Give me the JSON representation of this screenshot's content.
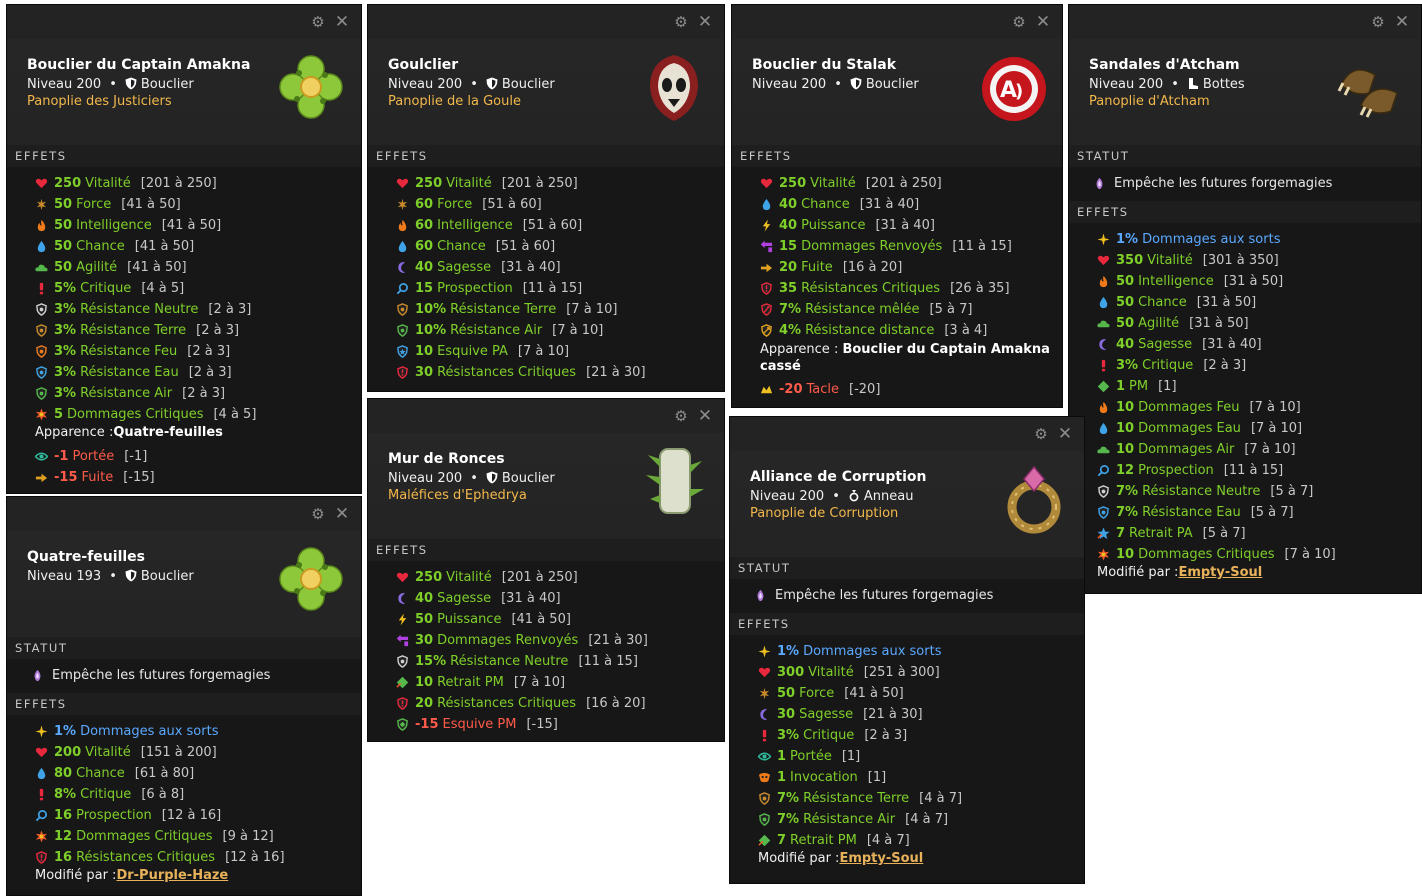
{
  "ui": {
    "gear": "⚙",
    "close": "✕",
    "dot": "•"
  },
  "panels": [
    {
      "name": "Bouclier du Captain Amakna",
      "level": "Niveau 200",
      "type": "Bouclier",
      "set": "Panoplie des Justiciers",
      "sections": [
        {
          "title": "EFFETS",
          "kind": "effects",
          "rows": [
            {
              "v": "250",
              "t": "Vitalité",
              "r": "[201 à 250]",
              "icon": "heart-icon",
              "color": "#e8283c"
            },
            {
              "v": "50",
              "t": "Force",
              "r": "[41 à 50]",
              "icon": "force-icon",
              "color": "#c98a2b"
            },
            {
              "v": "50",
              "t": "Intelligence",
              "r": "[41 à 50]",
              "icon": "fire-icon",
              "color": "#f07a1a"
            },
            {
              "v": "50",
              "t": "Chance",
              "r": "[41 à 50]",
              "icon": "water-drop-icon",
              "color": "#3fa3e8"
            },
            {
              "v": "50",
              "t": "Agilité",
              "r": "[41 à 50]",
              "icon": "air-cloud-icon",
              "color": "#56b84c"
            },
            {
              "v": "5%",
              "t": "Critique",
              "r": "[4 à 5]",
              "icon": "critical-icon",
              "color": "#e8283c"
            },
            {
              "v": "3%",
              "t": "Résistance Neutre",
              "r": "[2 à 3]",
              "icon": "shield-neutral-icon",
              "color": "#d0d0d0"
            },
            {
              "v": "3%",
              "t": "Résistance Terre",
              "r": "[2 à 3]",
              "icon": "shield-earth-icon",
              "color": "#c98a2b"
            },
            {
              "v": "3%",
              "t": "Résistance Feu",
              "r": "[2 à 3]",
              "icon": "shield-fire-icon",
              "color": "#f07a1a"
            },
            {
              "v": "3%",
              "t": "Résistance Eau",
              "r": "[2 à 3]",
              "icon": "shield-water-icon",
              "color": "#3fa3e8"
            },
            {
              "v": "3%",
              "t": "Résistance Air",
              "r": "[2 à 3]",
              "icon": "shield-air-icon",
              "color": "#56b84c"
            },
            {
              "v": "5",
              "t": "Dommages Critiques",
              "r": "[4 à 5]",
              "icon": "critical-damage-icon",
              "color": "#f05a28"
            },
            {
              "plain": true,
              "label": "Apparence : ",
              "value": "Quatre-feuilles"
            },
            {
              "v": "-1",
              "t": "Portée",
              "r": "[-1]",
              "icon": "range-eye-icon",
              "color": "#2fb89a",
              "neg": true
            },
            {
              "v": "-15",
              "t": "Fuite",
              "r": "[-15]",
              "icon": "flee-icon",
              "color": "#e0a020",
              "neg": true
            }
          ]
        }
      ]
    },
    {
      "name": "Goulclier",
      "level": "Niveau 200",
      "type": "Bouclier",
      "set": "Panoplie de la Goule",
      "sections": [
        {
          "title": "EFFETS",
          "kind": "effects",
          "rows": [
            {
              "v": "250",
              "t": "Vitalité",
              "r": "[201 à 250]",
              "icon": "heart-icon",
              "color": "#e8283c"
            },
            {
              "v": "60",
              "t": "Force",
              "r": "[51 à 60]",
              "icon": "force-icon",
              "color": "#c98a2b"
            },
            {
              "v": "60",
              "t": "Intelligence",
              "r": "[51 à 60]",
              "icon": "fire-icon",
              "color": "#f07a1a"
            },
            {
              "v": "60",
              "t": "Chance",
              "r": "[51 à 60]",
              "icon": "water-drop-icon",
              "color": "#3fa3e8"
            },
            {
              "v": "40",
              "t": "Sagesse",
              "r": "[31 à 40]",
              "icon": "wisdom-moon-icon",
              "color": "#8a6ae0"
            },
            {
              "v": "15",
              "t": "Prospection",
              "r": "[11 à 15]",
              "icon": "prospection-icon",
              "color": "#3fa3e8"
            },
            {
              "v": "10%",
              "t": "Résistance Terre",
              "r": "[7 à 10]",
              "icon": "shield-earth-icon",
              "color": "#c98a2b"
            },
            {
              "v": "10%",
              "t": "Résistance Air",
              "r": "[7 à 10]",
              "icon": "shield-air-icon",
              "color": "#56b84c"
            },
            {
              "v": "10",
              "t": "Esquive PA",
              "r": "[7 à 10]",
              "icon": "dodge-ap-icon",
              "color": "#3fa3e8"
            },
            {
              "v": "30",
              "t": "Résistances Critiques",
              "r": "[21 à 30]",
              "icon": "critical-resist-icon",
              "color": "#e8283c"
            }
          ]
        }
      ]
    },
    {
      "name": "Bouclier du Stalak",
      "level": "Niveau 200",
      "type": "Bouclier",
      "set": "",
      "sections": [
        {
          "title": "EFFETS",
          "kind": "effects",
          "rows": [
            {
              "v": "250",
              "t": "Vitalité",
              "r": "[201 à 250]",
              "icon": "heart-icon",
              "color": "#e8283c"
            },
            {
              "v": "40",
              "t": "Chance",
              "r": "[31 à 40]",
              "icon": "water-drop-icon",
              "color": "#3fa3e8"
            },
            {
              "v": "40",
              "t": "Puissance",
              "r": "[31 à 40]",
              "icon": "power-bolt-icon",
              "color": "#f0c020"
            },
            {
              "v": "15",
              "t": "Dommages Renvoyés",
              "r": "[11 à 15]",
              "icon": "reflect-icon",
              "color": "#b040e0"
            },
            {
              "v": "20",
              "t": "Fuite",
              "r": "[16 à 20]",
              "icon": "flee-icon",
              "color": "#e0a020"
            },
            {
              "v": "35",
              "t": "Résistances Critiques",
              "r": "[26 à 35]",
              "icon": "critical-resist-icon",
              "color": "#e8283c"
            },
            {
              "v": "7%",
              "t": "Résistance mêlée",
              "r": "[5 à 7]",
              "icon": "melee-resist-icon",
              "color": "#e8283c"
            },
            {
              "v": "4%",
              "t": "Résistance distance",
              "r": "[3 à 4]",
              "icon": "ranged-resist-icon",
              "color": "#e0a020"
            },
            {
              "plain": true,
              "label": "Apparence : ",
              "value": "Bouclier du Captain Amakna cassé",
              "tall": true
            },
            {
              "v": "-20",
              "t": "Tacle",
              "r": "[-20]",
              "icon": "tackle-icon",
              "color": "#f0c020",
              "neg": true
            }
          ]
        }
      ]
    },
    {
      "name": "Sandales d'Atcham",
      "level": "Niveau 200",
      "type": "Bottes",
      "set": "Panoplie d'Atcham",
      "sections": [
        {
          "title": "STATUT",
          "kind": "statut",
          "text": "Empêche les futures forgemagies"
        },
        {
          "title": "EFFETS",
          "kind": "effects",
          "rows": [
            {
              "v": "1%",
              "t": "Dommages aux sorts",
              "r": "",
              "icon": "spell-damage-icon",
              "color": "#f0c020",
              "blue": true
            },
            {
              "v": "350",
              "t": "Vitalité",
              "r": "[301 à 350]",
              "icon": "heart-icon",
              "color": "#e8283c"
            },
            {
              "v": "50",
              "t": "Intelligence",
              "r": "[31 à 50]",
              "icon": "fire-icon",
              "color": "#f07a1a"
            },
            {
              "v": "50",
              "t": "Chance",
              "r": "[31 à 50]",
              "icon": "water-drop-icon",
              "color": "#3fa3e8"
            },
            {
              "v": "50",
              "t": "Agilité",
              "r": "[31 à 50]",
              "icon": "air-cloud-icon",
              "color": "#56b84c"
            },
            {
              "v": "40",
              "t": "Sagesse",
              "r": "[31 à 40]",
              "icon": "wisdom-moon-icon",
              "color": "#8a6ae0"
            },
            {
              "v": "3%",
              "t": "Critique",
              "r": "[2 à 3]",
              "icon": "critical-icon",
              "color": "#e8283c"
            },
            {
              "v": "1",
              "t": "PM",
              "r": "[1]",
              "icon": "movement-point-icon",
              "color": "#56b84c"
            },
            {
              "v": "10",
              "t": "Dommages Feu",
              "r": "[7 à 10]",
              "icon": "fire-icon",
              "color": "#f07a1a"
            },
            {
              "v": "10",
              "t": "Dommages Eau",
              "r": "[7 à 10]",
              "icon": "water-drop-icon",
              "color": "#3fa3e8"
            },
            {
              "v": "10",
              "t": "Dommages Air",
              "r": "[7 à 10]",
              "icon": "air-cloud-icon",
              "color": "#56b84c"
            },
            {
              "v": "12",
              "t": "Prospection",
              "r": "[11 à 15]",
              "icon": "prospection-icon",
              "color": "#3fa3e8"
            },
            {
              "v": "7%",
              "t": "Résistance Neutre",
              "r": "[5 à 7]",
              "icon": "shield-neutral-icon",
              "color": "#d0d0d0"
            },
            {
              "v": "7%",
              "t": "Résistance Eau",
              "r": "[5 à 7]",
              "icon": "shield-water-icon",
              "color": "#3fa3e8"
            },
            {
              "v": "7",
              "t": "Retrait PA",
              "r": "[5 à 7]",
              "icon": "ap-reduction-icon",
              "color": "#3fa3e8"
            },
            {
              "v": "10",
              "t": "Dommages Critiques",
              "r": "[7 à 10]",
              "icon": "critical-damage-icon",
              "color": "#f05a28"
            },
            {
              "plain": true,
              "label": "Modifié par : ",
              "value": "Empty-Soul",
              "mod": true
            }
          ]
        }
      ]
    },
    {
      "name": "Quatre-feuilles",
      "level": "Niveau 193",
      "type": "Bouclier",
      "set": "",
      "sections": [
        {
          "title": "STATUT",
          "kind": "statut",
          "text": "Empêche les futures forgemagies"
        },
        {
          "title": "EFFETS",
          "kind": "effects",
          "rows": [
            {
              "v": "1%",
              "t": "Dommages aux sorts",
              "r": "",
              "icon": "spell-damage-icon",
              "color": "#f0c020",
              "blue": true
            },
            {
              "v": "200",
              "t": "Vitalité",
              "r": "[151 à 200]",
              "icon": "heart-icon",
              "color": "#e8283c"
            },
            {
              "v": "80",
              "t": "Chance",
              "r": "[61 à 80]",
              "icon": "water-drop-icon",
              "color": "#3fa3e8"
            },
            {
              "v": "8%",
              "t": "Critique",
              "r": "[6 à 8]",
              "icon": "critical-icon",
              "color": "#e8283c"
            },
            {
              "v": "16",
              "t": "Prospection",
              "r": "[12 à 16]",
              "icon": "prospection-icon",
              "color": "#3fa3e8"
            },
            {
              "v": "12",
              "t": "Dommages Critiques",
              "r": "[9 à 12]",
              "icon": "critical-damage-icon",
              "color": "#f05a28"
            },
            {
              "v": "16",
              "t": "Résistances Critiques",
              "r": "[12 à 16]",
              "icon": "critical-resist-icon",
              "color": "#e8283c"
            },
            {
              "plain": true,
              "label": "Modifié par : ",
              "value": "Dr-Purple-Haze",
              "mod": true
            }
          ]
        }
      ]
    },
    {
      "name": "Mur de Ronces",
      "level": "Niveau 200",
      "type": "Bouclier",
      "set": "Maléfices d'Ephedrya",
      "sections": [
        {
          "title": "EFFETS",
          "kind": "effects",
          "rows": [
            {
              "v": "250",
              "t": "Vitalité",
              "r": "[201 à 250]",
              "icon": "heart-icon",
              "color": "#e8283c"
            },
            {
              "v": "40",
              "t": "Sagesse",
              "r": "[31 à 40]",
              "icon": "wisdom-moon-icon",
              "color": "#8a6ae0"
            },
            {
              "v": "50",
              "t": "Puissance",
              "r": "[41 à 50]",
              "icon": "power-bolt-icon",
              "color": "#f0c020"
            },
            {
              "v": "30",
              "t": "Dommages Renvoyés",
              "r": "[21 à 30]",
              "icon": "reflect-icon",
              "color": "#b040e0"
            },
            {
              "v": "15%",
              "t": "Résistance Neutre",
              "r": "[11 à 15]",
              "icon": "shield-neutral-icon",
              "color": "#d0d0d0"
            },
            {
              "v": "10",
              "t": "Retrait PM",
              "r": "[7 à 10]",
              "icon": "mp-reduction-icon",
              "color": "#56b84c"
            },
            {
              "v": "20",
              "t": "Résistances Critiques",
              "r": "[16 à 20]",
              "icon": "critical-resist-icon",
              "color": "#e8283c"
            },
            {
              "v": "-15",
              "t": "Esquive PM",
              "r": "[-15]",
              "icon": "dodge-mp-icon",
              "color": "#56b84c",
              "neg": true
            }
          ]
        }
      ]
    },
    {
      "name": "Alliance de Corruption",
      "level": "Niveau 200",
      "type": "Anneau",
      "set": "Panoplie de Corruption",
      "sections": [
        {
          "title": "STATUT",
          "kind": "statut",
          "text": "Empêche les futures forgemagies"
        },
        {
          "title": "EFFETS",
          "kind": "effects",
          "rows": [
            {
              "v": "1%",
              "t": "Dommages aux sorts",
              "r": "",
              "icon": "spell-damage-icon",
              "color": "#f0c020",
              "blue": true
            },
            {
              "v": "300",
              "t": "Vitalité",
              "r": "[251 à 300]",
              "icon": "heart-icon",
              "color": "#e8283c"
            },
            {
              "v": "50",
              "t": "Force",
              "r": "[41 à 50]",
              "icon": "force-icon",
              "color": "#c98a2b"
            },
            {
              "v": "30",
              "t": "Sagesse",
              "r": "[21 à 30]",
              "icon": "wisdom-moon-icon",
              "color": "#8a6ae0"
            },
            {
              "v": "3%",
              "t": "Critique",
              "r": "[2 à 3]",
              "icon": "critical-icon",
              "color": "#e8283c"
            },
            {
              "v": "1",
              "t": "Portée",
              "r": "[1]",
              "icon": "range-eye-icon",
              "color": "#2fb89a"
            },
            {
              "v": "1",
              "t": "Invocation",
              "r": "[1]",
              "icon": "summon-icon",
              "color": "#f07a1a"
            },
            {
              "v": "7%",
              "t": "Résistance Terre",
              "r": "[4 à 7]",
              "icon": "shield-earth-icon",
              "color": "#c98a2b"
            },
            {
              "v": "7%",
              "t": "Résistance Air",
              "r": "[4 à 7]",
              "icon": "shield-air-icon",
              "color": "#56b84c"
            },
            {
              "v": "7",
              "t": "Retrait PM",
              "r": "[4 à 7]",
              "icon": "mp-reduction-icon",
              "color": "#56b84c"
            },
            {
              "plain": true,
              "label": "Modifié par : ",
              "value": "Empty-Soul",
              "mod": true
            }
          ]
        }
      ]
    }
  ]
}
